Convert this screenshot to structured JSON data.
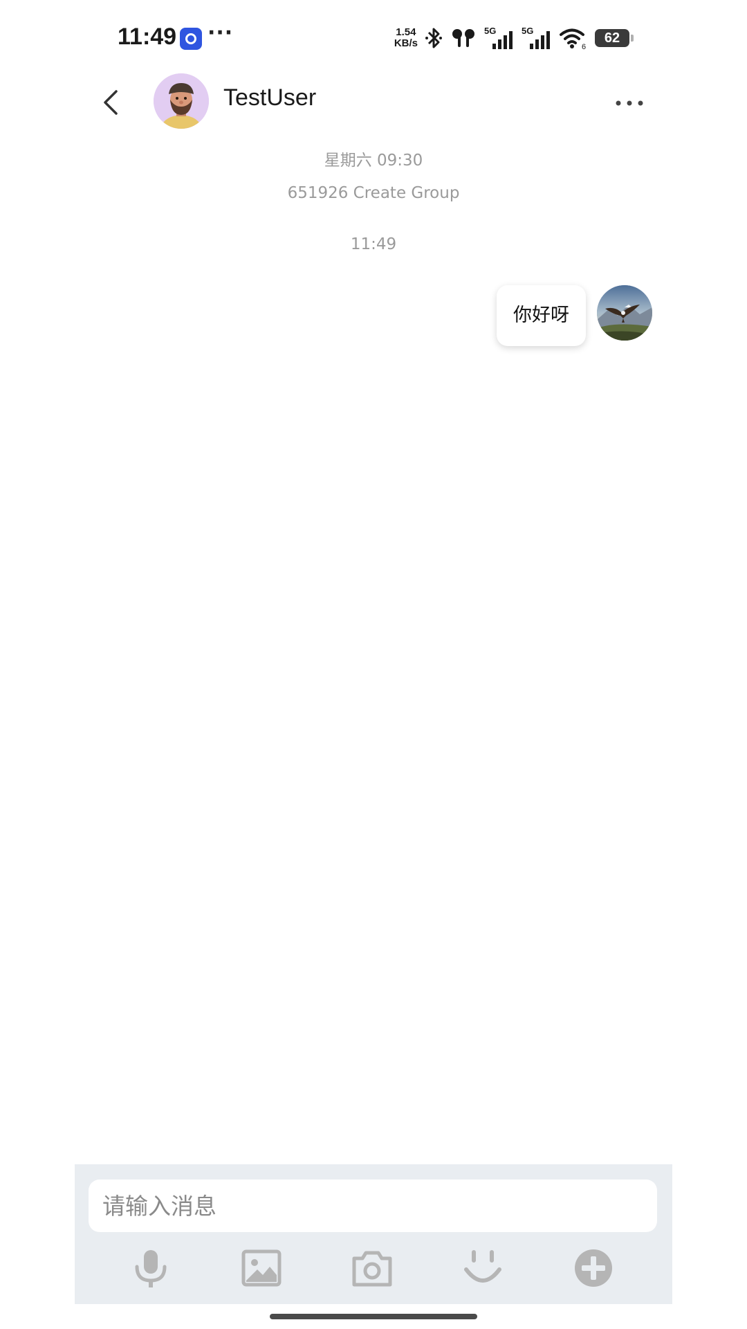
{
  "status_bar": {
    "time": "11:49",
    "more": "···",
    "net_speed_value": "1.54",
    "net_speed_unit": "KB/s",
    "signal_1_label": "5G",
    "signal_2_label": "5G",
    "wifi_label": "6",
    "battery": "62"
  },
  "header": {
    "contact_name": "TestUser"
  },
  "chat": {
    "timestamp_1": "星期六 09:30",
    "system_message": "651926 Create Group",
    "timestamp_2": "11:49",
    "messages": [
      {
        "sender": "self",
        "text": "你好呀"
      }
    ]
  },
  "input": {
    "placeholder": "请输入消息"
  },
  "colors": {
    "panel_bg": "#e9edf1",
    "system_text": "#9a9a9a",
    "icon_gray": "#b5b5b5",
    "app_icon_blue": "#2f55e0"
  },
  "toolbar_icons": [
    "microphone-icon",
    "image-icon",
    "camera-icon",
    "emoji-icon",
    "plus-icon"
  ]
}
